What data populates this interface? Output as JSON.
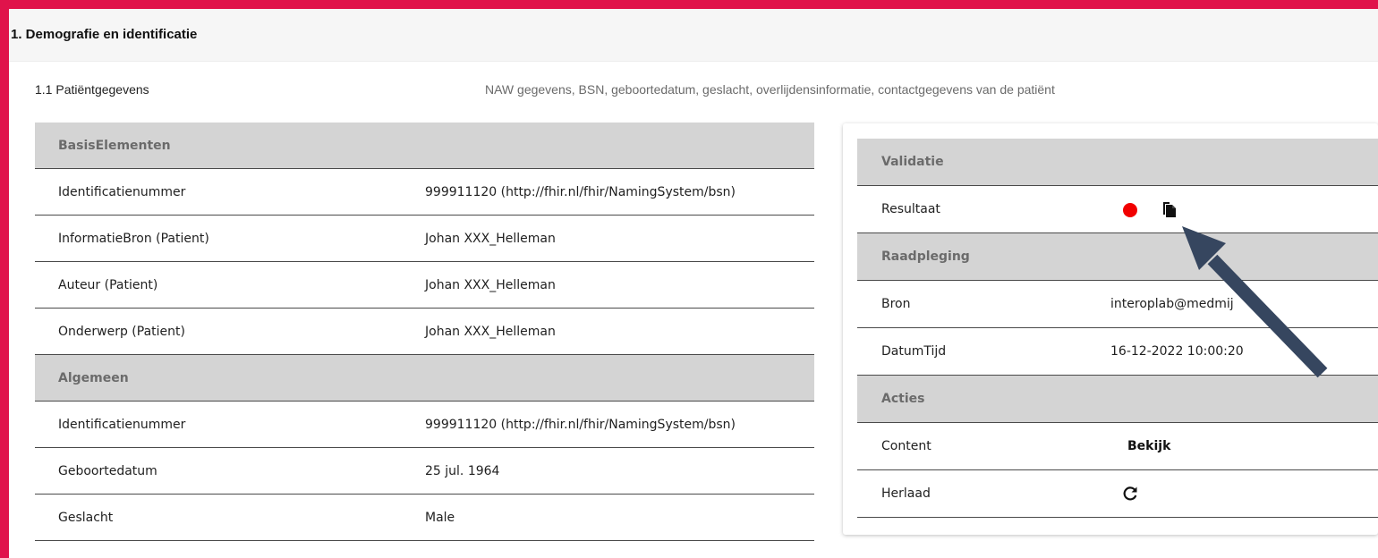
{
  "section": {
    "title": "1. Demografie en identificatie",
    "subsection_title": "1.1 Patiëntgegevens",
    "subsection_desc": "NAW gegevens, BSN, geboortedatum, geslacht, overlijdensinformatie, contactgegevens van de patiënt"
  },
  "left_table": {
    "groups": [
      {
        "header": "BasisElementen",
        "rows": [
          {
            "label": "Identificatienummer",
            "value": "999911120 (http://fhir.nl/fhir/NamingSystem/bsn)"
          },
          {
            "label": "InformatieBron (Patient)",
            "value": "Johan XXX_Helleman"
          },
          {
            "label": "Auteur (Patient)",
            "value": "Johan XXX_Helleman"
          },
          {
            "label": "Onderwerp (Patient)",
            "value": "Johan XXX_Helleman"
          }
        ]
      },
      {
        "header": "Algemeen",
        "rows": [
          {
            "label": "Identificatienummer",
            "value": "999911120 (http://fhir.nl/fhir/NamingSystem/bsn)"
          },
          {
            "label": "Geboortedatum",
            "value": "25 jul. 1964"
          },
          {
            "label": "Geslacht",
            "value": "Male"
          }
        ]
      }
    ]
  },
  "right_card": {
    "validatie": {
      "header": "Validatie",
      "resultaat_label": "Resultaat",
      "status_color": "#f10000",
      "status_icon": "red-status-dot-icon",
      "copy_icon": "copy-document-icon"
    },
    "raadpleging": {
      "header": "Raadpleging",
      "bron_label": "Bron",
      "bron_value": "interoplab@medmij",
      "datumtijd_label": "DatumTijd",
      "datumtijd_value": "16-12-2022 10:00:20"
    },
    "acties": {
      "header": "Acties",
      "content_label": "Content",
      "content_action": "Bekijk",
      "herlaad_label": "Herlaad",
      "herlaad_icon": "reload-icon"
    }
  },
  "colors": {
    "frame": "#e0134b",
    "group_header_bg": "#d4d4d4",
    "annotation_arrow": "#36465f"
  }
}
